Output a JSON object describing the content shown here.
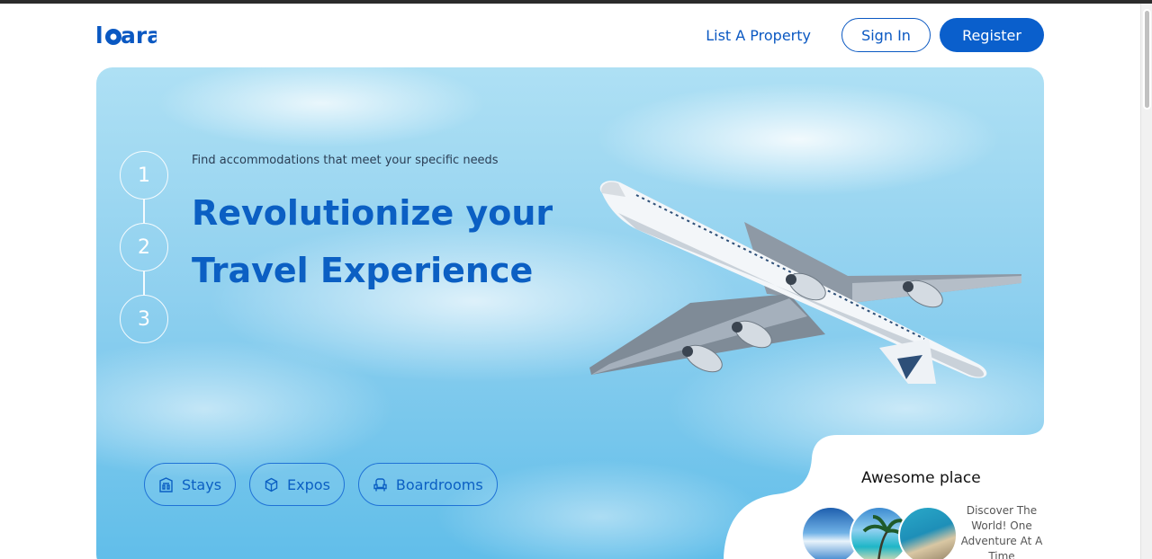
{
  "header": {
    "logo_text": "laara",
    "list_property": "List A Property",
    "sign_in": "Sign In",
    "register": "Register"
  },
  "hero": {
    "steps": [
      "1",
      "2",
      "3"
    ],
    "subtitle": "Find accommodations that meet your specific needs",
    "headline_line1": "Revolutionize your",
    "headline_line2": "Travel Experience",
    "categories": [
      {
        "label": "Stays",
        "icon": "hotel-icon"
      },
      {
        "label": "Expos",
        "icon": "cube-icon"
      },
      {
        "label": "Boardrooms",
        "icon": "armchair-icon"
      }
    ]
  },
  "card": {
    "title": "Awesome place",
    "text": "Discover The World! One Adventure At A Time"
  },
  "colors": {
    "brand": "#0a5fcc",
    "headline": "#0b5fc3",
    "sky_top": "#aee0f4",
    "sky_bottom": "#5fbde9"
  }
}
